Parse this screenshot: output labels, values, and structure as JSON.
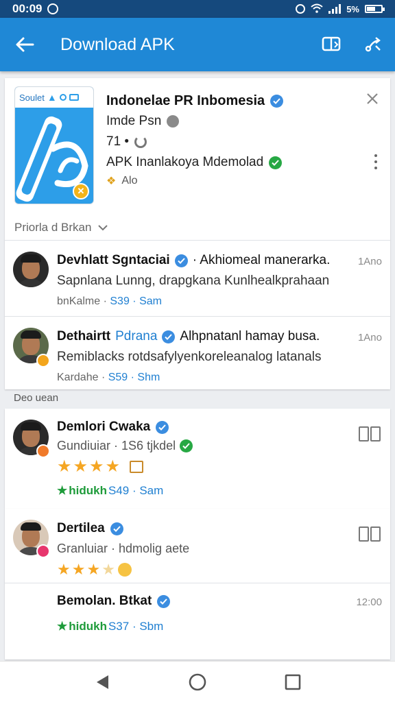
{
  "status": {
    "time": "00:09",
    "battery_text": "5%"
  },
  "appbar": {
    "title": "Download APK"
  },
  "app": {
    "thumb_label": "Soulet",
    "title": "Indonelae PR Inbomesia",
    "line1": "Imde Psn",
    "line2": "71 •",
    "line3": "APK Inanlakoya Mdemolad",
    "line4": "Alo",
    "sort_label": "Priorla d Brkan"
  },
  "comments": [
    {
      "name": "Devhlatt Sgntaciai",
      "text_inline": "· Akhiomeal manerarka.",
      "body": "Sapnlana Lunng, drapgkana Kunlhealkprahaan",
      "meta_prefix": "bnKalme ·",
      "meta_link": "S39 · Sam",
      "time": "1Ano"
    },
    {
      "name": "Dethairtt",
      "name_link": "Pdrana",
      "text_inline": "Alhpnatanl hamay busa.",
      "body": "Remiblacks rotdsafylyenkoreleanalog latanals",
      "meta_prefix": "Kardahe ·",
      "meta_link": "S59 · Shm",
      "time": "1Ano"
    }
  ],
  "section_label": "Deo uean",
  "reviews": [
    {
      "name": "Demlori Cwaka",
      "sub": "Gundiuiar · 1S6 tjkdel",
      "stars": 4,
      "meta_green": "hidukh",
      "meta_link": "S49 · Sam"
    },
    {
      "name": "Dertilea",
      "sub": "Granluiar · hdmolig aete",
      "stars": 3,
      "meta_green": "",
      "meta_link": ""
    },
    {
      "name": "Bemolan. Btkat",
      "sub": "",
      "stars": 0,
      "meta_green": "hidukh",
      "meta_link": "S37 · Sbm",
      "time": "12:00"
    }
  ],
  "colors": {
    "statusbar": "#15497d",
    "appbar": "#1f88d6",
    "accent": "#1f7fd1",
    "green": "#1e9b3a",
    "star": "#f5a623"
  }
}
